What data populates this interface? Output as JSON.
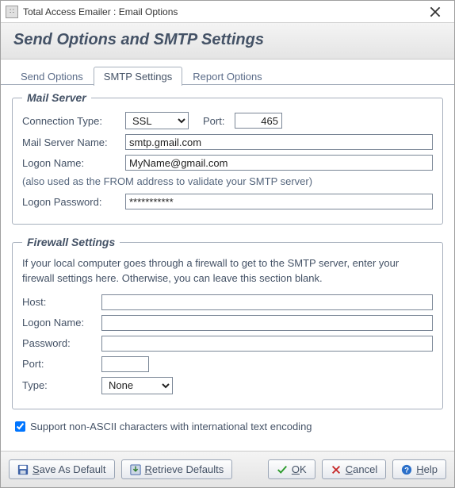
{
  "window": {
    "title": "Total Access Emailer : Email Options"
  },
  "header": {
    "title": "Send Options and SMTP Settings"
  },
  "tabs": {
    "send_options": "Send Options",
    "smtp_settings": "SMTP Settings",
    "report_options": "Report Options",
    "active": "smtp_settings"
  },
  "mail_server": {
    "legend": "Mail Server",
    "connection_type_label": "Connection Type:",
    "connection_type_value": "SSL",
    "port_label": "Port:",
    "port_value": "465",
    "server_name_label": "Mail Server Name:",
    "server_name_value": "smtp.gmail.com",
    "logon_name_label": "Logon Name:",
    "logon_name_value": "MyName@gmail.com",
    "logon_note": "(also used as the FROM address to validate your SMTP server)",
    "logon_password_label": "Logon Password:",
    "logon_password_value": "***********"
  },
  "firewall": {
    "legend": "Firewall Settings",
    "note": "If your local computer goes through a firewall to get to the SMTP server, enter your firewall settings here. Otherwise, you can leave this section blank.",
    "host_label": "Host:",
    "host_value": "",
    "logon_name_label": "Logon Name:",
    "logon_name_value": "",
    "password_label": "Password:",
    "password_value": "",
    "port_label": "Port:",
    "port_value": "",
    "type_label": "Type:",
    "type_value": "None"
  },
  "encoding": {
    "checked": true,
    "label": "Support non-ASCII characters with international text encoding"
  },
  "buttons": {
    "save_default": {
      "pre": "",
      "u": "S",
      "post": "ave As Default"
    },
    "retrieve_defaults": {
      "pre": "",
      "u": "R",
      "post": "etrieve Defaults"
    },
    "ok": {
      "pre": "",
      "u": "O",
      "post": "K"
    },
    "cancel": {
      "pre": "",
      "u": "C",
      "post": "ancel"
    },
    "help": {
      "pre": "",
      "u": "H",
      "post": "elp"
    }
  }
}
